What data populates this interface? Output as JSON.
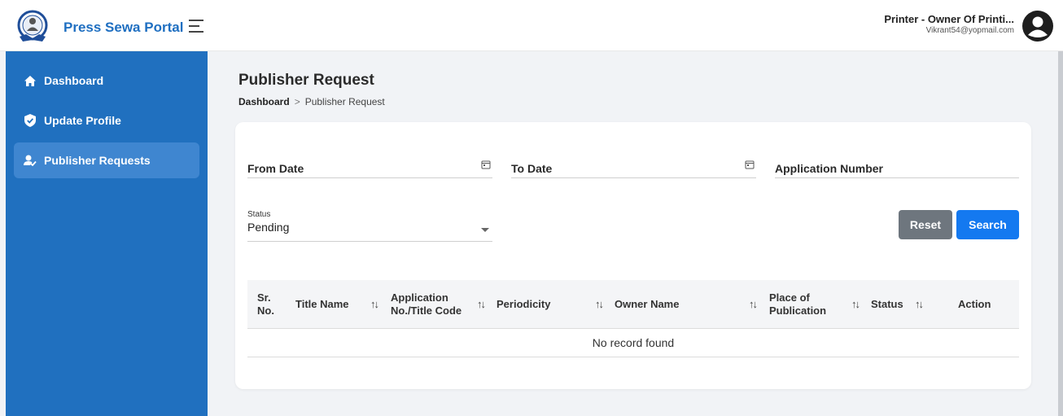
{
  "header": {
    "brand": "Press Sewa Portal",
    "user_name": "Printer - Owner Of Printi...",
    "user_email": "Vikrant54@yopmail.com"
  },
  "sidebar": {
    "items": [
      {
        "label": "Dashboard",
        "icon": "home-icon"
      },
      {
        "label": "Update Profile",
        "icon": "shield-check-icon"
      },
      {
        "label": "Publisher Requests",
        "icon": "user-check-icon",
        "active": true
      }
    ]
  },
  "page": {
    "title": "Publisher Request",
    "breadcrumb": {
      "home": "Dashboard",
      "separator": ">",
      "current": "Publisher Request"
    }
  },
  "filters": {
    "from_date_label": "From Date",
    "to_date_label": "To Date",
    "application_number_label": "Application Number",
    "status_caption": "Status",
    "status_value": "Pending",
    "reset_label": "Reset",
    "search_label": "Search"
  },
  "table": {
    "columns": [
      {
        "line1": "Sr.",
        "line2": "No."
      },
      {
        "line1": "Title Name",
        "line2": ""
      },
      {
        "line1": "Application",
        "line2": "No./Title Code"
      },
      {
        "line1": "Periodicity",
        "line2": ""
      },
      {
        "line1": "Owner Name",
        "line2": ""
      },
      {
        "line1": "Place of",
        "line2": "Publication"
      },
      {
        "line1": "Status",
        "line2": ""
      },
      {
        "line1": "Action",
        "line2": ""
      }
    ],
    "empty_message": "No record found"
  },
  "colors": {
    "sidebar": "#2070bf",
    "sidebar_active": "#3f86d0",
    "brand": "#1f6fc1",
    "search_button": "#1479f0",
    "reset_button": "#6e767e"
  }
}
